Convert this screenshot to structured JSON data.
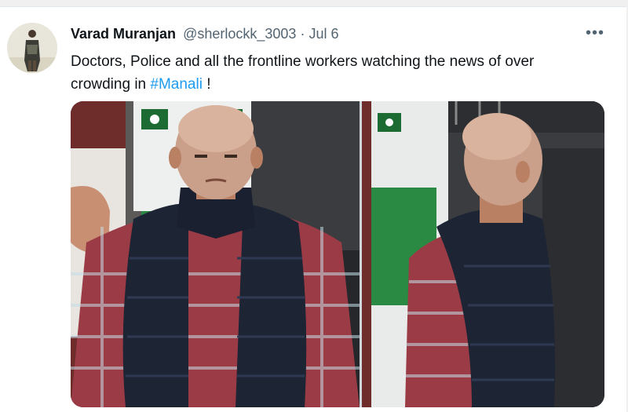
{
  "tweet": {
    "author_name": "Varad Muranjan",
    "handle": "@sherlockk_3003",
    "separator": "·",
    "date": "Jul 6",
    "more_icon": "more-horizontal-icon",
    "text_before": "Doctors, Police and all the frontline workers watching the news of over crowding in ",
    "hashtag": "#Manali",
    "text_after": " !"
  },
  "colors": {
    "link": "#1d9bf0",
    "text": "#0f1419",
    "secondary": "#536471"
  }
}
